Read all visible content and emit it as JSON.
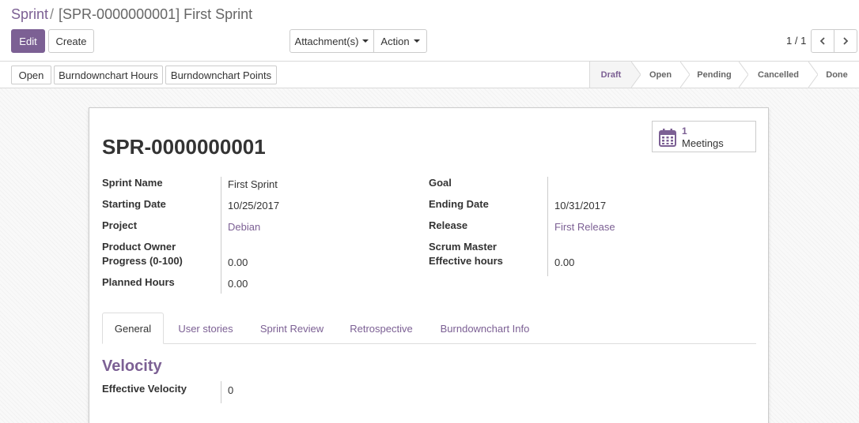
{
  "breadcrumb": {
    "parent": "Sprint",
    "separator": "/",
    "current": "[SPR-0000000001] First Sprint"
  },
  "toolbar": {
    "edit_label": "Edit",
    "create_label": "Create",
    "attachments_label": "Attachment(s)",
    "action_label": "Action"
  },
  "pager": {
    "value": "1 / 1"
  },
  "header_buttons": {
    "open": "Open",
    "burndown_hours": "Burndownchart Hours",
    "burndown_points": "Burndownchart Points"
  },
  "stages": {
    "draft": "Draft",
    "open": "Open",
    "pending": "Pending",
    "cancelled": "Cancelled",
    "done": "Done",
    "active": "Draft"
  },
  "smart_button": {
    "count": "1",
    "label": "Meetings",
    "icon": "calendar-icon"
  },
  "record": {
    "title": "SPR-0000000001"
  },
  "fields": {
    "sprint_name": {
      "label": "Sprint Name",
      "value": "First Sprint"
    },
    "starting_date": {
      "label": "Starting Date",
      "value": "10/25/2017"
    },
    "project": {
      "label": "Project",
      "value": "Debian"
    },
    "product_owner": {
      "label": "Product Owner",
      "value": ""
    },
    "progress": {
      "label": "Progress (0-100)",
      "value": "0.00"
    },
    "planned_hours": {
      "label": "Planned Hours",
      "value": "0.00"
    },
    "goal": {
      "label": "Goal",
      "value": ""
    },
    "ending_date": {
      "label": "Ending Date",
      "value": "10/31/2017"
    },
    "release": {
      "label": "Release",
      "value": "First Release"
    },
    "scrum_master": {
      "label": "Scrum Master",
      "value": ""
    },
    "effective_hours": {
      "label": "Effective hours",
      "value": "0.00"
    }
  },
  "tabs": {
    "general": "General",
    "user_stories": "User stories",
    "sprint_review": "Sprint Review",
    "retrospective": "Retrospective",
    "burndown_info": "Burndownchart Info",
    "active": "General"
  },
  "velocity": {
    "title": "Velocity",
    "effective_velocity_label": "Effective Velocity",
    "effective_velocity_value": "0"
  },
  "colors": {
    "brand": "#7c6094",
    "border": "#cccccc"
  }
}
